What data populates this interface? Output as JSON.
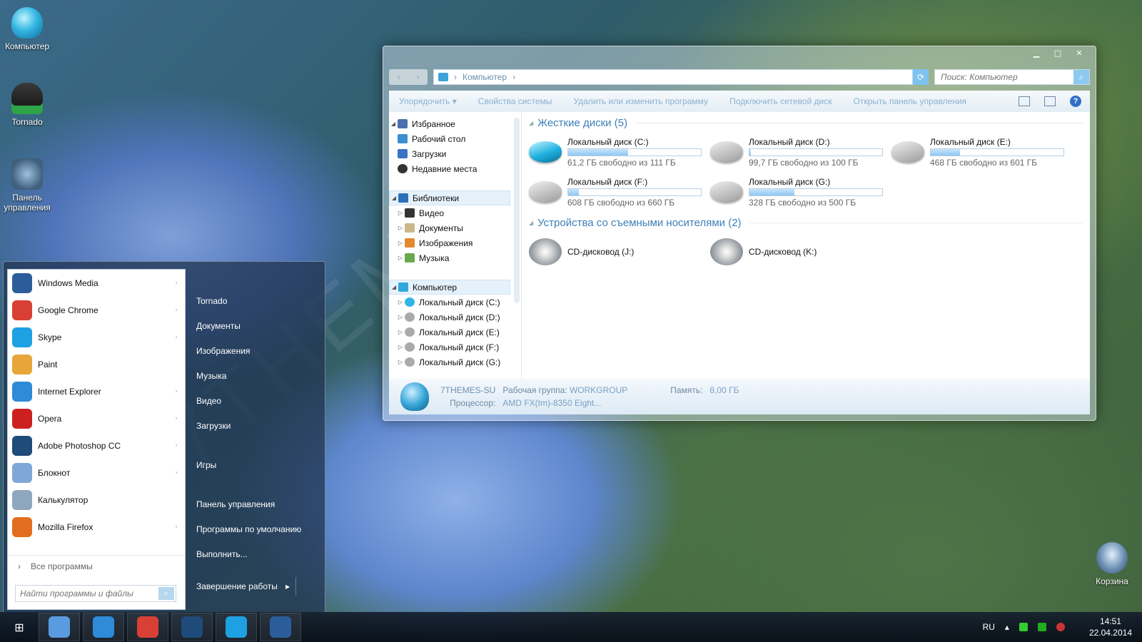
{
  "desktop": {
    "icons": [
      {
        "label": "Компьютер"
      },
      {
        "label": "Tornado"
      },
      {
        "label": "Панель управления"
      },
      {
        "label": "Корзина"
      }
    ]
  },
  "explorer": {
    "address": {
      "location": "Компьютер"
    },
    "search": {
      "placeholder": "Поиск: Компьютер"
    },
    "toolbar": {
      "organize": "Упорядочить",
      "system_props": "Свойства системы",
      "uninstall": "Удалить или изменить программу",
      "map_drive": "Подключить сетевой диск",
      "control_panel": "Открыть панель управления"
    },
    "nav": {
      "favorites": "Избранное",
      "desktop": "Рабочий стол",
      "downloads": "Загрузки",
      "recent": "Недавние места",
      "libraries": "Библиотеки",
      "video": "Видео",
      "documents": "Документы",
      "images": "Изображения",
      "music": "Музыка",
      "computer": "Компьютер",
      "drives": [
        "Локальный диск (C:)",
        "Локальный диск (D:)",
        "Локальный диск (E:)",
        "Локальный диск (F:)",
        "Локальный диск (G:)"
      ]
    },
    "hard_drives_title": "Жесткие диски (5)",
    "hard_drives": [
      {
        "name": "Локальный диск (C:)",
        "free": "61,2 ГБ свободно из 111 ГБ",
        "used_fraction": 0.45
      },
      {
        "name": "Локальный диск (D:)",
        "free": "99,7 ГБ свободно из 100 ГБ",
        "used_fraction": 0.003
      },
      {
        "name": "Локальный диск (E:)",
        "free": "468 ГБ свободно из 601 ГБ",
        "used_fraction": 0.22
      },
      {
        "name": "Локальный диск (F:)",
        "free": "608 ГБ свободно из 660 ГБ",
        "used_fraction": 0.08
      },
      {
        "name": "Локальный диск (G:)",
        "free": "328 ГБ свободно из 500 ГБ",
        "used_fraction": 0.34
      }
    ],
    "removable_title": "Устройства со съемными носителями (2)",
    "removable": [
      {
        "name": "CD-дисковод (J:)"
      },
      {
        "name": "CD-дисковод (K:)"
      }
    ],
    "status": {
      "computer_name": "7THEMES-SU",
      "workgroup_label": "Рабочая группа:",
      "workgroup": "WORKGROUP",
      "memory_label": "Память:",
      "memory": "8,00 ГБ",
      "cpu_label": "Процессор:",
      "cpu": "AMD FX(tm)-8350 Eight..."
    }
  },
  "startmenu": {
    "programs": [
      {
        "label": "Windows Media",
        "color": "#2b5d9a",
        "submenu": true
      },
      {
        "label": "Google Chrome",
        "color": "#d94035",
        "submenu": true
      },
      {
        "label": "Skype",
        "color": "#1da1e2",
        "submenu": true
      },
      {
        "label": "Paint",
        "color": "#e7a53a",
        "submenu": false
      },
      {
        "label": "Internet Explorer",
        "color": "#2f8ad8",
        "submenu": true
      },
      {
        "label": "Opera",
        "color": "#cc1f1f",
        "submenu": true
      },
      {
        "label": "Adobe Photoshop CC",
        "color": "#1f4b7a",
        "submenu": true
      },
      {
        "label": "Блокнот",
        "color": "#7fa8d8",
        "submenu": true
      },
      {
        "label": "Калькулятор",
        "color": "#8fa6bf",
        "submenu": false
      },
      {
        "label": "Mozilla Firefox",
        "color": "#e36d1f",
        "submenu": true
      }
    ],
    "all_programs": "Все программы",
    "search_placeholder": "Найти программы и файлы",
    "places": [
      "Tornado",
      "Документы",
      "Изображения",
      "Музыка",
      "Видео",
      "Загрузки",
      "Игры",
      "Панель управления",
      "Программы по умолчанию",
      "Выполнить..."
    ],
    "shutdown": "Завершение работы"
  },
  "taskbar": {
    "apps": [
      {
        "name": "explorer",
        "color": "#5a9be0"
      },
      {
        "name": "internet-explorer",
        "color": "#2f8ad8"
      },
      {
        "name": "chrome",
        "color": "#d94035"
      },
      {
        "name": "photoshop",
        "color": "#1f4b7a"
      },
      {
        "name": "skype",
        "color": "#1da1e2"
      },
      {
        "name": "windows-media",
        "color": "#2b5d9a"
      }
    ],
    "lang": "RU",
    "time": "14:51",
    "date": "22.04.2014"
  }
}
